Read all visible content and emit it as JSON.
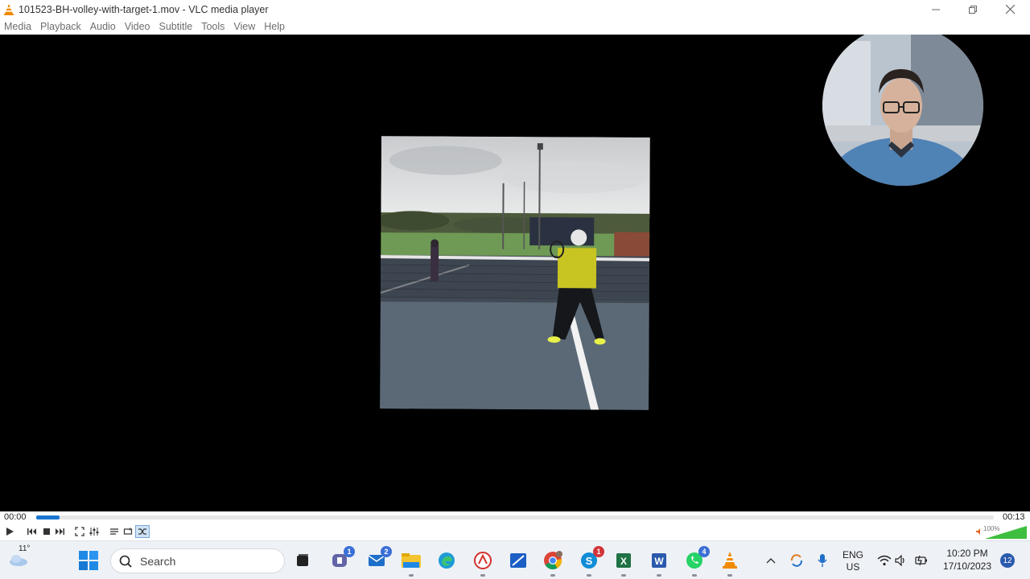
{
  "window": {
    "title": "101523-BH-volley-with-target-1.mov - VLC media player",
    "controls": [
      "minimize",
      "restore",
      "close"
    ]
  },
  "menu": [
    "Media",
    "Playback",
    "Audio",
    "Video",
    "Subtitle",
    "Tools",
    "View",
    "Help"
  ],
  "player": {
    "elapsed": "00:00",
    "total": "00:13",
    "progress_fraction": 0.024,
    "volume_label": "100%",
    "volume_fraction": 1.0,
    "accent_color": "#1976d2"
  },
  "taskbar": {
    "weather_temp": "11°",
    "search_placeholder": "Search",
    "apps": [
      {
        "name": "teams-icon",
        "badge": "1",
        "badge_color": "#3b6fd6"
      },
      {
        "name": "mail-icon",
        "badge": "2",
        "badge_color": "#3b6fd6"
      },
      {
        "name": "file-explorer-icon"
      },
      {
        "name": "edge-icon"
      },
      {
        "name": "acrobat-icon"
      },
      {
        "name": "snipping-tool-icon"
      },
      {
        "name": "chrome-icon"
      },
      {
        "name": "skype-icon",
        "badge": "1",
        "badge_color": "#d13438"
      },
      {
        "name": "excel-icon"
      },
      {
        "name": "word-icon"
      },
      {
        "name": "whatsapp-icon",
        "badge": "4",
        "badge_color": "#3b6fd6"
      },
      {
        "name": "vlc-icon"
      }
    ],
    "language_line1": "ENG",
    "language_line2": "US",
    "clock_time": "10:20 PM",
    "clock_date": "17/10/2023",
    "notification_count": "12"
  }
}
